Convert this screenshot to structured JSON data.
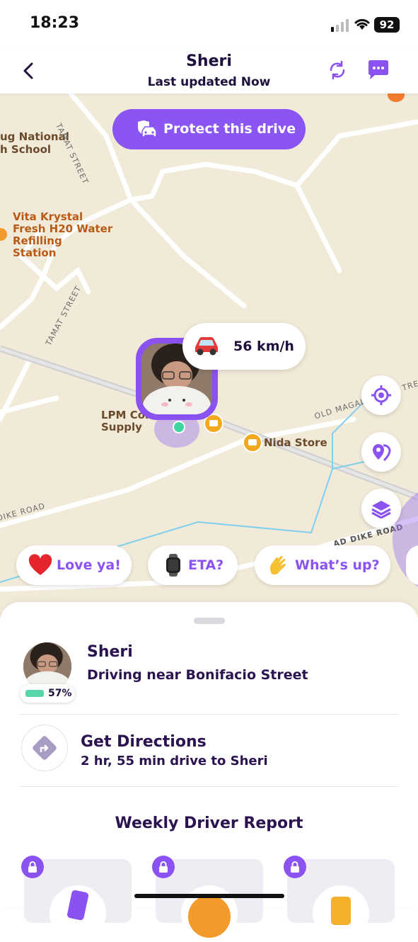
{
  "status_bar": {
    "time": "18:23",
    "battery": "92"
  },
  "header": {
    "name": "Sheri",
    "subtitle": "Last updated Now"
  },
  "map": {
    "protect_button": "Protect this drive",
    "speed": "56 km/h",
    "labels": {
      "school": "ug National\nh School",
      "water_station": "Vita Krystal\nFresh H20 Water\nRefilling\nStation",
      "lpm": "LPM Construction\nSupply",
      "nida": "Nida Store"
    },
    "streets": {
      "tamat_1": "TAMAT STREET",
      "tamat_2": "TAMAT STREET",
      "old_magal": "OLD MAGAL",
      "tre": "TRE",
      "dike_left": "DIKE ROAD",
      "dike_right": "AD DIKE ROAD"
    },
    "quick_messages": [
      "Love ya!",
      "ETA?",
      "What’s up?"
    ]
  },
  "person": {
    "name": "Sheri",
    "status": "Driving near Bonifacio Street",
    "battery": "57%"
  },
  "directions": {
    "title": "Get Directions",
    "subtitle": "2 hr, 55 min drive to Sheri"
  },
  "report": {
    "title": "Weekly Driver Report"
  },
  "colors": {
    "accent": "#8b52f2",
    "map_bg": "#f1ead8",
    "text_dark": "#2b1350"
  }
}
